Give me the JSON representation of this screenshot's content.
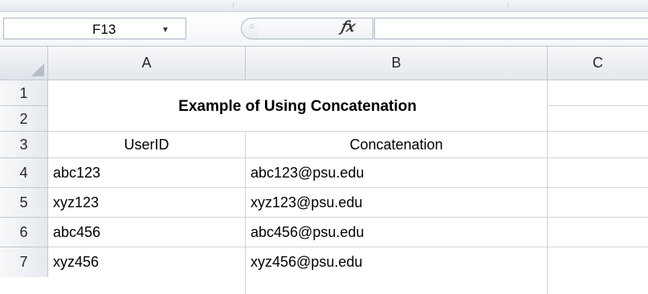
{
  "formula_bar": {
    "name_box_value": "F13",
    "fx_label": "fx",
    "formula_value": ""
  },
  "columns": [
    "A",
    "B",
    "C"
  ],
  "rows": [
    "1",
    "2",
    "3",
    "4",
    "5",
    "6",
    "7"
  ],
  "sheet": {
    "title": "Example of Using Concatenation",
    "header_userid": "UserID",
    "header_concatenation": "Concatenation",
    "data": [
      {
        "userid": "abc123",
        "email": "abc123@psu.edu"
      },
      {
        "userid": "xyz123",
        "email": "xyz123@psu.edu"
      },
      {
        "userid": "abc456",
        "email": "abc456@psu.edu"
      },
      {
        "userid": "xyz456",
        "email": "xyz456@psu.edu"
      }
    ]
  }
}
